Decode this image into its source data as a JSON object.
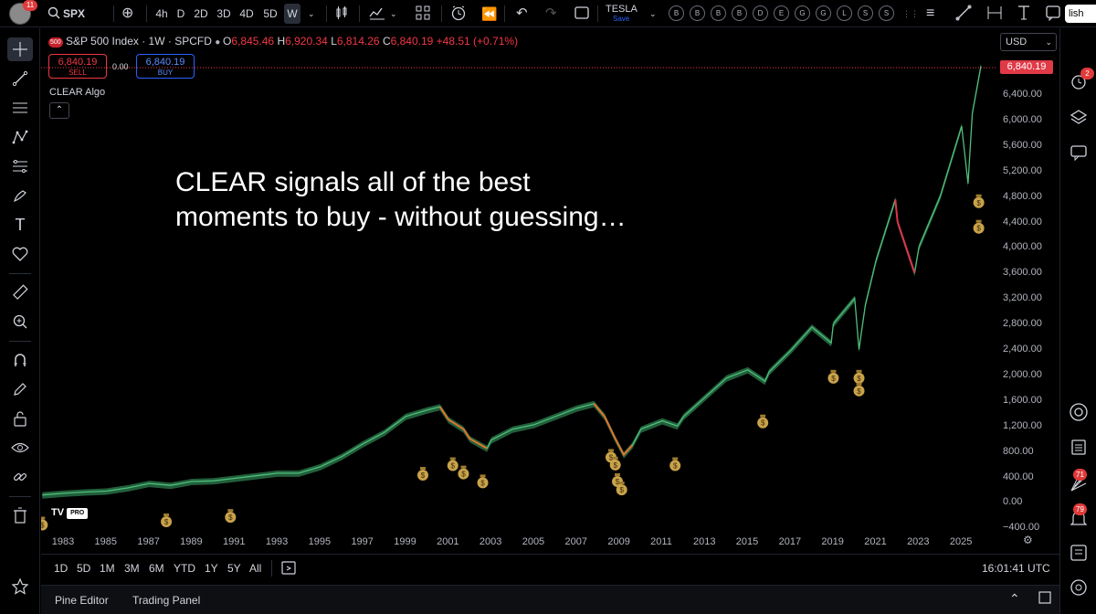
{
  "toolbar": {
    "avatar_badge": "11",
    "symbol": "SPX",
    "timeframes": [
      "4h",
      "D",
      "2D",
      "3D",
      "4D",
      "5D",
      "W"
    ],
    "active_timeframe": "W",
    "layout_name": "TESLA",
    "layout_status": "Save",
    "indicator_letters": [
      "B",
      "B",
      "B",
      "B",
      "D",
      "E",
      "G",
      "G",
      "L",
      "S",
      "S"
    ],
    "publish_label": "lish"
  },
  "legend": {
    "logo_text": "500",
    "title": "S&P 500 Index · 1W · SPCFD",
    "open_key": "O",
    "open": "6,845.46",
    "high_key": "H",
    "high": "6,920.34",
    "low_key": "L",
    "low": "6,814.26",
    "close_key": "C",
    "close": "6,840.19",
    "change": "+48.51 (+0.71%)"
  },
  "trade": {
    "sell_price": "6,840.19",
    "sell_label": "SELL",
    "spread": "0.00",
    "buy_price": "6,840.19",
    "buy_label": "BUY"
  },
  "indicator_name": "CLEAR Algo",
  "overlay_text_line1": "CLEAR signals all of the best",
  "overlay_text_line2": "moments to buy - without guessing…",
  "currency": "USD",
  "current_price": "6,840.19",
  "price_axis": [
    "6,400.00",
    "6,000.00",
    "5,600.00",
    "5,200.00",
    "4,800.00",
    "4,400.00",
    "4,000.00",
    "3,600.00",
    "3,200.00",
    "2,800.00",
    "2,400.00",
    "2,000.00",
    "1,600.00",
    "1,200.00",
    "800.00",
    "400.00",
    "0.00",
    "−400.00"
  ],
  "time_axis": [
    "1983",
    "1985",
    "1987",
    "1989",
    "1991",
    "1993",
    "1995",
    "1997",
    "1999",
    "2001",
    "2003",
    "2005",
    "2007",
    "2009",
    "2011",
    "2013",
    "2015",
    "2017",
    "2019",
    "2021",
    "2023",
    "2025"
  ],
  "watermark": "TV",
  "watermark_badge": "PRO",
  "ranges": [
    "1D",
    "5D",
    "1M",
    "3M",
    "6M",
    "YTD",
    "1Y",
    "5Y",
    "All"
  ],
  "clock": "16:01:41 UTC",
  "bottom_tabs": [
    "Pine Editor",
    "Trading Panel"
  ],
  "right_badges": {
    "alerts": "2",
    "ideas": "71",
    "notifications": "79"
  },
  "chart_data": {
    "type": "line",
    "title": "S&P 500 Index · 1W · SPCFD",
    "ylim": [
      -400,
      6900
    ],
    "x": [
      1982,
      1983,
      1984,
      1985,
      1986,
      1987,
      1988,
      1989,
      1990,
      1991,
      1992,
      1993,
      1994,
      1995,
      1996,
      1997,
      1998,
      1999,
      2000,
      2000.6,
      2001,
      2001.7,
      2002,
      2002.8,
      2003,
      2004,
      2005,
      2006,
      2007,
      2007.8,
      2008.3,
      2008.8,
      2009.2,
      2009.6,
      2010,
      2011,
      2011.7,
      2012,
      2013,
      2014,
      2015,
      2015.8,
      2016,
      2017,
      2018,
      2018.9,
      2019,
      2020,
      2020.2,
      2020.5,
      2021,
      2021.9,
      2022,
      2022.8,
      2023,
      2024,
      2025,
      2025.3,
      2025.5,
      2025.9
    ],
    "y": [
      120,
      145,
      165,
      180,
      230,
      300,
      270,
      330,
      340,
      380,
      420,
      460,
      460,
      560,
      720,
      920,
      1100,
      1350,
      1450,
      1500,
      1300,
      1150,
      1000,
      850,
      980,
      1150,
      1220,
      1350,
      1480,
      1550,
      1350,
      1000,
      750,
      900,
      1150,
      1280,
      1200,
      1350,
      1650,
      1950,
      2080,
      1900,
      2050,
      2380,
      2750,
      2500,
      2800,
      3200,
      2400,
      3100,
      3800,
      4750,
      4400,
      3600,
      4000,
      4800,
      5900,
      5000,
      6100,
      6840
    ],
    "buy_signals": [
      {
        "x": 1982,
        "y": -350
      },
      {
        "x": 1987.8,
        "y": -300
      },
      {
        "x": 1990.8,
        "y": -230
      },
      {
        "x": 1999.8,
        "y": 430
      },
      {
        "x": 2001.2,
        "y": 580
      },
      {
        "x": 2001.7,
        "y": 450
      },
      {
        "x": 2002.6,
        "y": 310
      },
      {
        "x": 2008.6,
        "y": 710
      },
      {
        "x": 2008.8,
        "y": 590
      },
      {
        "x": 2008.9,
        "y": 330
      },
      {
        "x": 2009.1,
        "y": 200
      },
      {
        "x": 2011.6,
        "y": 580
      },
      {
        "x": 2015.7,
        "y": 1250
      },
      {
        "x": 2019.0,
        "y": 1950
      },
      {
        "x": 2020.2,
        "y": 1950
      },
      {
        "x": 2020.2,
        "y": 1750
      },
      {
        "x": 2025.8,
        "y": 4700
      },
      {
        "x": 2025.8,
        "y": 4300
      }
    ]
  }
}
